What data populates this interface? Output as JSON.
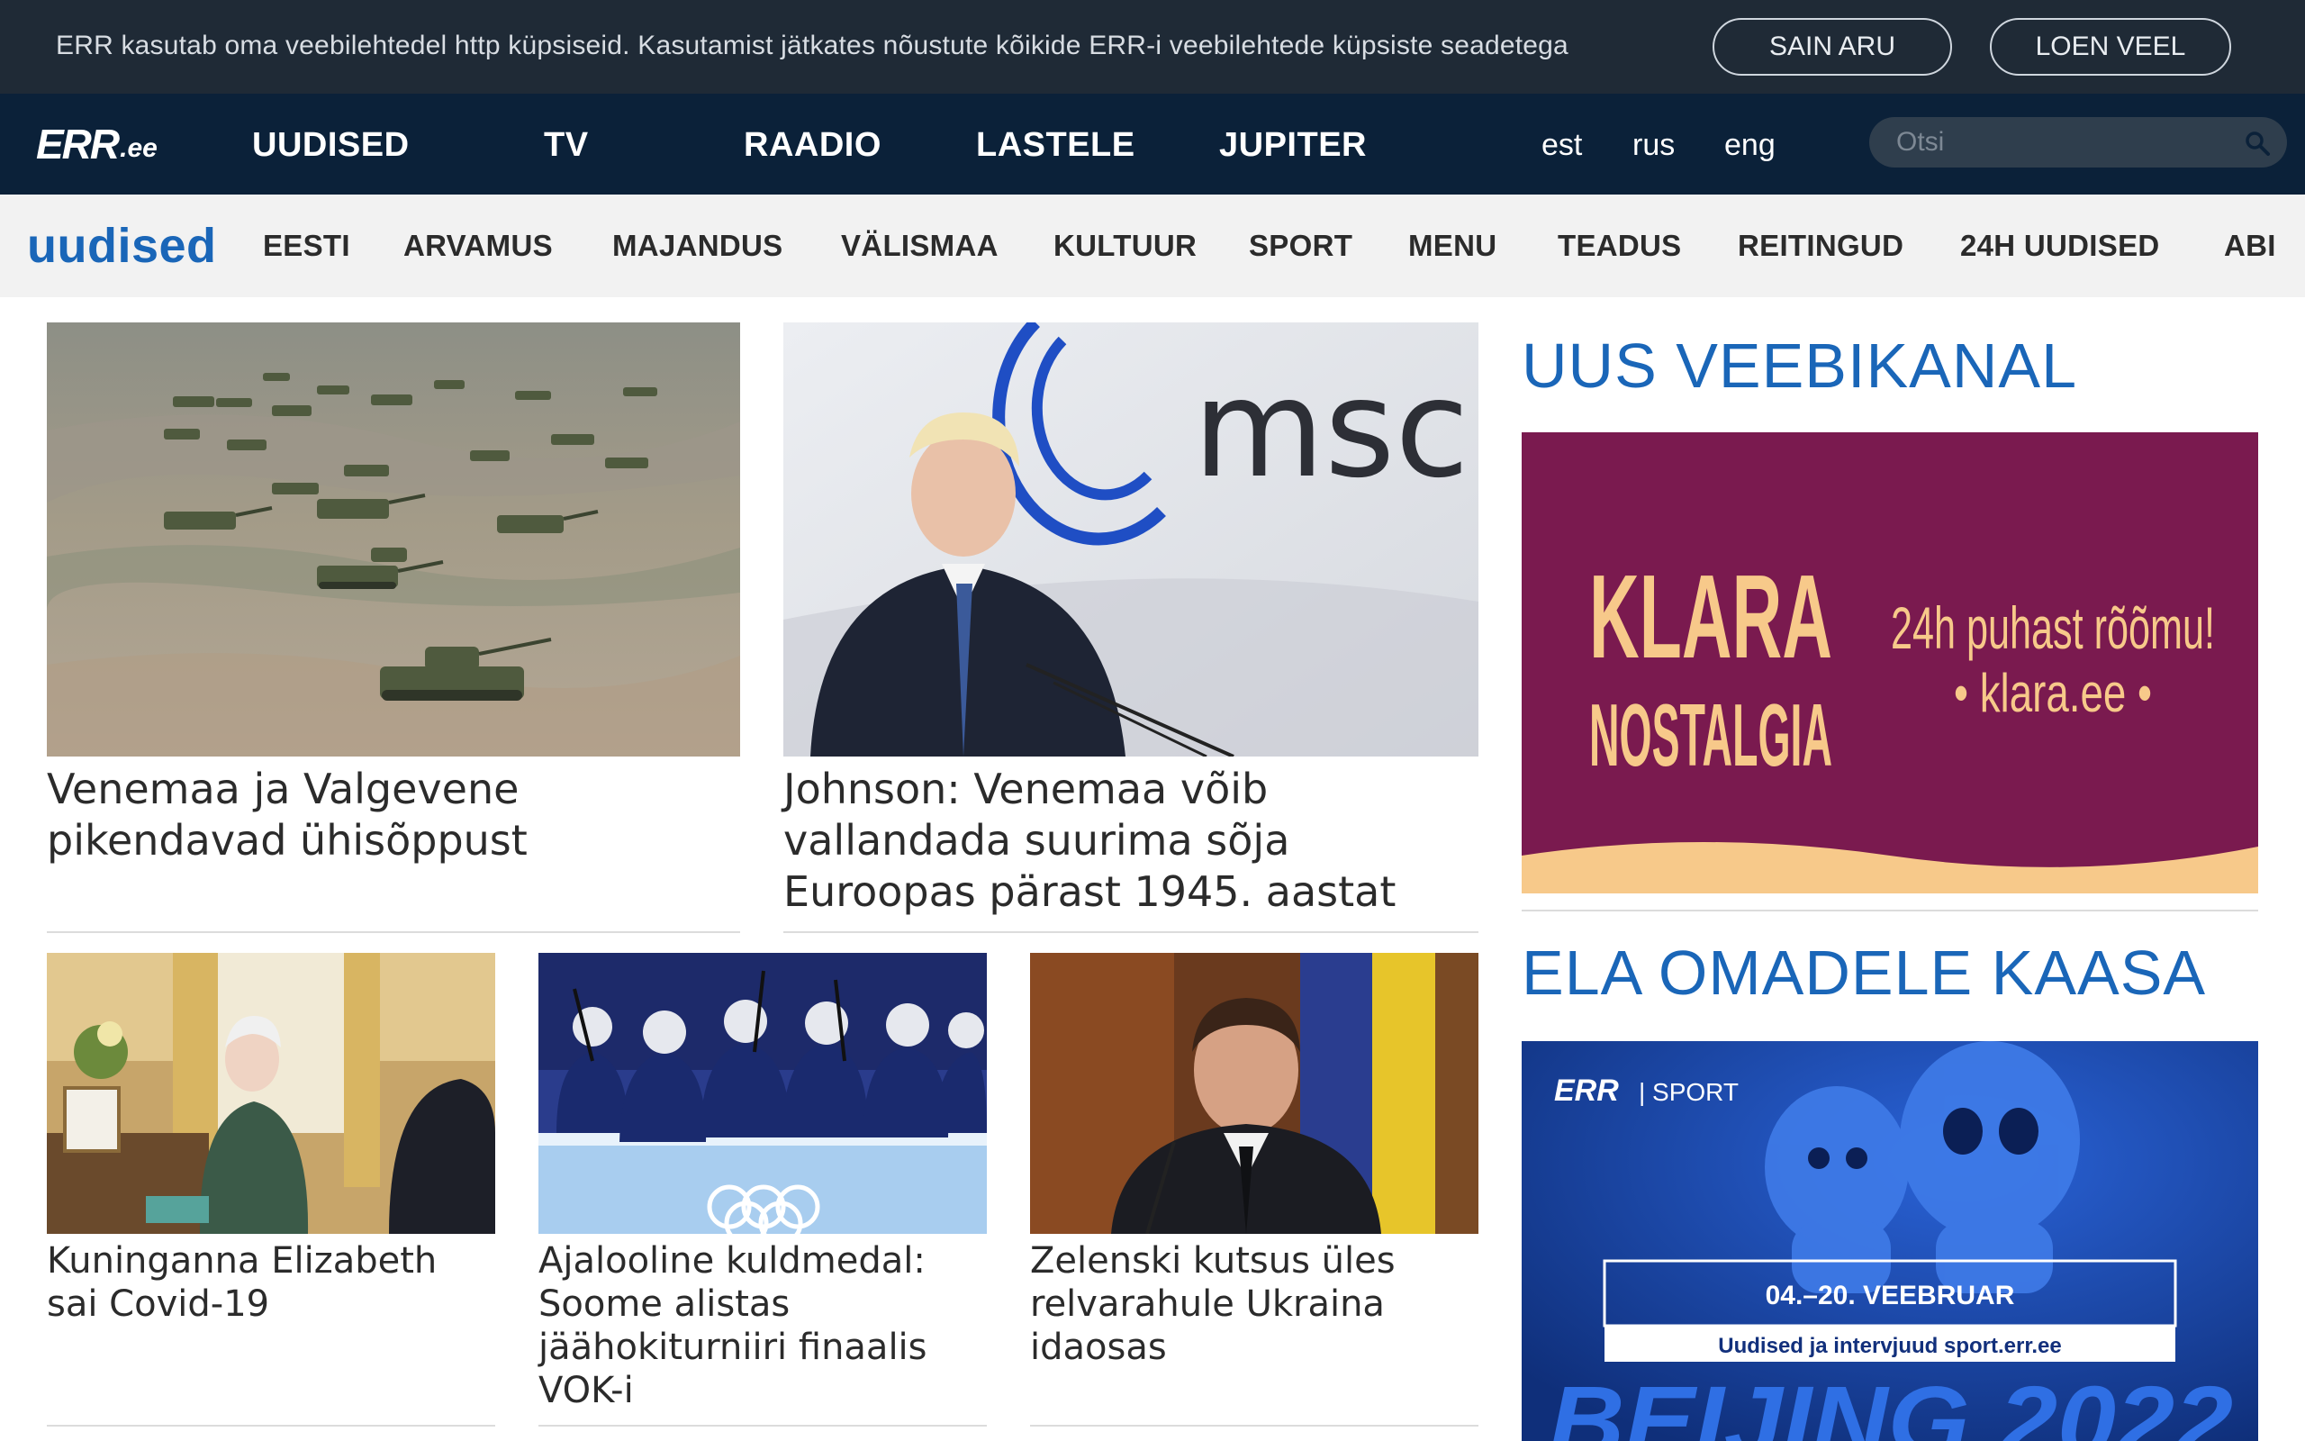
{
  "cookie": {
    "text": "ERR kasutab oma veebilehtedel http küpsiseid. Kasutamist jätkates nõustute kõikide ERR-i veebilehtede küpsiste seadetega",
    "accept_label": "SAIN ARU",
    "more_label": "LOEN VEEL"
  },
  "top_nav": {
    "logo": "ERR",
    "logo_suffix": ".ee",
    "items": [
      "UUDISED",
      "TV",
      "RAADIO",
      "LASTELE",
      "JUPITER"
    ],
    "languages": [
      "est",
      "rus",
      "eng"
    ],
    "search_placeholder": "Otsi"
  },
  "section_nav": {
    "brand": "uudised",
    "items": [
      "EESTI",
      "ARVAMUS",
      "MAJANDUS",
      "VÄLISMAA",
      "KULTUUR",
      "SPORT",
      "MENU",
      "TEADUS",
      "REITINGUD",
      "24H UUDISED",
      "ABI"
    ]
  },
  "articles": {
    "a1": {
      "title": "Venemaa ja Valgevene pikendavad ühisõppust"
    },
    "a2": {
      "title": "Johnson: Venemaa võib vallandada suurima sõja Euroopas pärast 1945. aastat",
      "image_text": "msc"
    },
    "a3": {
      "title": "Kuninganna Elizabeth sai Covid-19"
    },
    "a4": {
      "title": "Ajalooline kuldmedal: Soome alistas jäähokiturniiri finaalis VOK-i"
    },
    "a5": {
      "title": "Zelenski kutsus üles relvarahule Ukraina idaosas"
    }
  },
  "sidebar": {
    "heading1": "UUS VEEBIKANAL",
    "klara_title_1": "KLARA",
    "klara_title_2": "NOSTALGIA",
    "klara_slogan": "24h puhast rõõmu!",
    "klara_url": "• klara.ee •",
    "heading2": "ELA OMADELE KAASA",
    "sport_logo": "ERR",
    "sport_label": "| SPORT",
    "sport_dates": "04.–20. VEEBRUAR",
    "sport_sub": "Uudised ja intervjuud sport.err.ee",
    "sport_bottom": "BEIJING 2022"
  },
  "colors": {
    "cookie_bg": "#1f2a36",
    "nav_bg": "#0b2139",
    "section_bg": "#f2f2f2",
    "accent": "#1a66b8",
    "klara_bg": "#7a1a4f",
    "klara_text": "#f7c98a",
    "sport_bg": "#123a8c"
  }
}
